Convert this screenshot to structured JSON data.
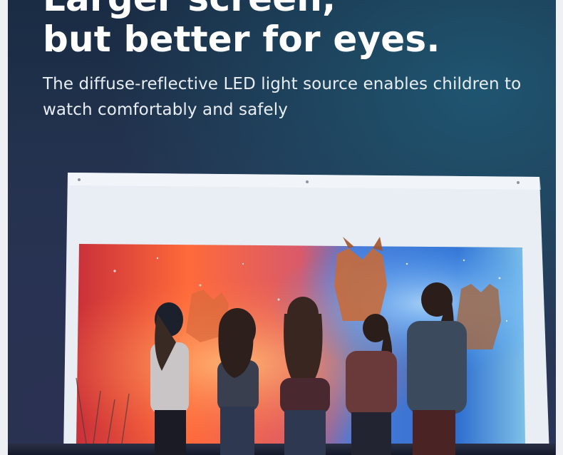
{
  "headline": {
    "line1": "Larger screen,",
    "line2": "but better for eyes."
  },
  "subtitle": "The diffuse-reflective LED light source enables children to watch comfortably and safely",
  "colors": {
    "background": "#1b2a40",
    "headline": "#ffffff",
    "subtitle": "#e8edf3",
    "screen_warm": "#ff5a3a",
    "screen_cool": "#3a9cff"
  }
}
